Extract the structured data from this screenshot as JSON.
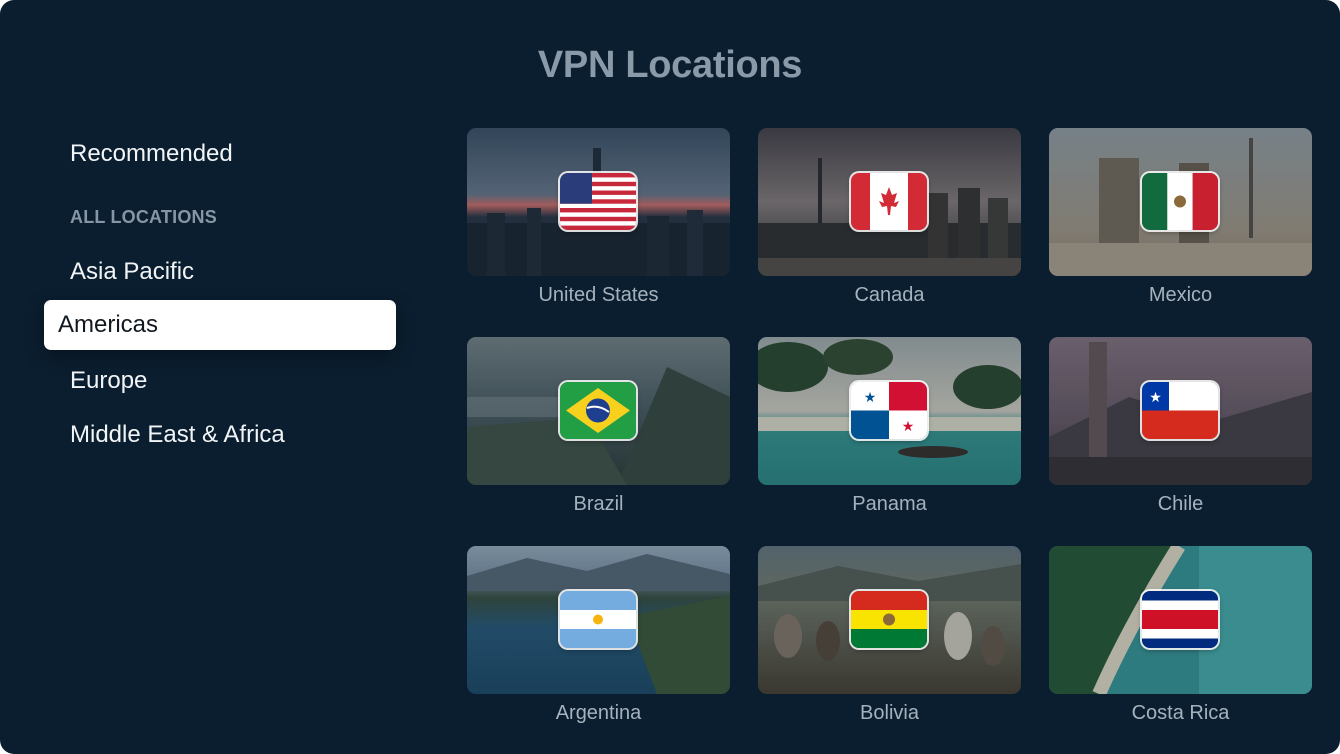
{
  "header": {
    "title": "VPN Locations"
  },
  "sidebar": {
    "recommended": "Recommended",
    "section_heading": "ALL LOCATIONS",
    "items": [
      {
        "label": "Asia Pacific"
      },
      {
        "label": "Americas",
        "selected": true
      },
      {
        "label": "Europe"
      },
      {
        "label": "Middle East & Africa"
      }
    ]
  },
  "locations": [
    {
      "name": "United States",
      "flag": "us-flag-icon"
    },
    {
      "name": "Canada",
      "flag": "canada-flag-icon"
    },
    {
      "name": "Mexico",
      "flag": "mexico-flag-icon"
    },
    {
      "name": "Brazil",
      "flag": "brazil-flag-icon"
    },
    {
      "name": "Panama",
      "flag": "panama-flag-icon"
    },
    {
      "name": "Chile",
      "flag": "chile-flag-icon"
    },
    {
      "name": "Argentina",
      "flag": "argentina-flag-icon"
    },
    {
      "name": "Bolivia",
      "flag": "bolivia-flag-icon"
    },
    {
      "name": "Costa Rica",
      "flag": "costa-rica-flag-icon"
    }
  ],
  "colors": {
    "background": "#0b1e2f",
    "title": "#8a9aa8",
    "selected_bg": "#ffffff",
    "label": "#a5b2bd"
  }
}
